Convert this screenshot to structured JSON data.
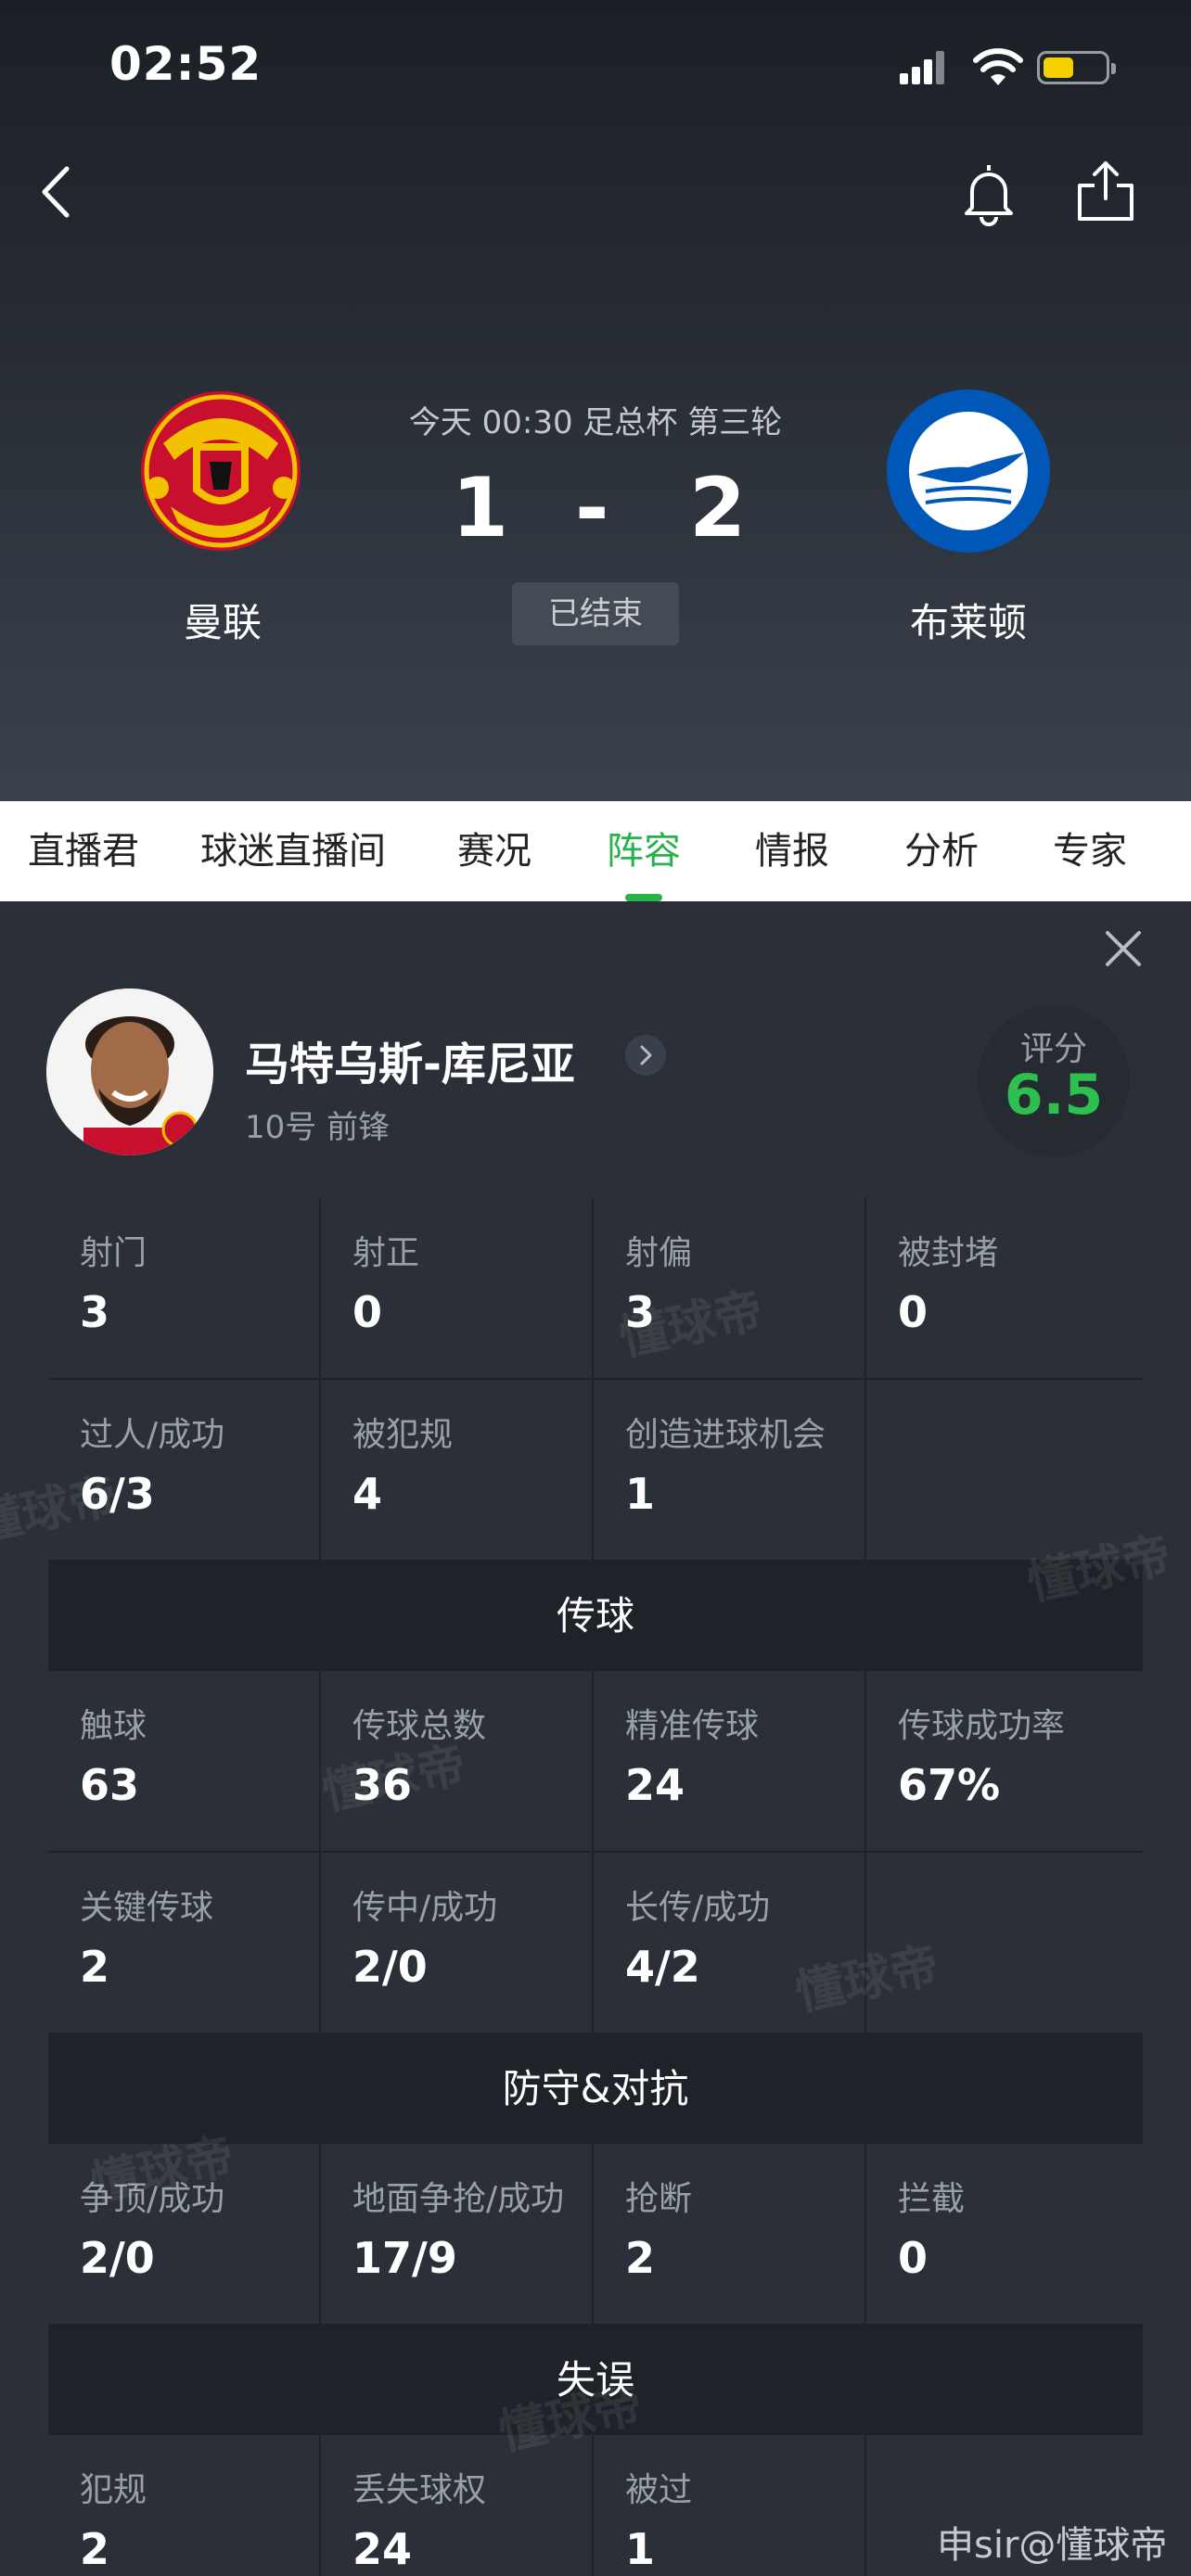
{
  "status_bar": {
    "time": "02:52"
  },
  "match": {
    "meta": "今天 00:30 足总杯 第三轮",
    "home_team": "曼联",
    "away_team": "布莱顿",
    "home_score": "1",
    "separator": "-",
    "away_score": "2",
    "status": "已结束"
  },
  "tabs": [
    {
      "label": "直播君"
    },
    {
      "label": "球迷直播间"
    },
    {
      "label": "赛况"
    },
    {
      "label": "阵容"
    },
    {
      "label": "情报"
    },
    {
      "label": "分析"
    },
    {
      "label": "专家"
    }
  ],
  "active_tab": "阵容",
  "player": {
    "name": "马特乌斯-库尼亚",
    "meta": "10号 前锋",
    "rating_label": "评分",
    "rating": "6.5"
  },
  "stats": {
    "row1": [
      {
        "label": "射门",
        "value": "3"
      },
      {
        "label": "射正",
        "value": "0"
      },
      {
        "label": "射偏",
        "value": "3"
      },
      {
        "label": "被封堵",
        "value": "0"
      }
    ],
    "row2": [
      {
        "label": "过人/成功",
        "value": "6/3"
      },
      {
        "label": "被犯规",
        "value": "4"
      },
      {
        "label": "创造进球机会",
        "value": "1"
      }
    ],
    "passing_title": "传球",
    "row3": [
      {
        "label": "触球",
        "value": "63"
      },
      {
        "label": "传球总数",
        "value": "36"
      },
      {
        "label": "精准传球",
        "value": "24"
      },
      {
        "label": "传球成功率",
        "value": "67%"
      }
    ],
    "row4": [
      {
        "label": "关键传球",
        "value": "2"
      },
      {
        "label": "传中/成功",
        "value": "2/0"
      },
      {
        "label": "长传/成功",
        "value": "4/2"
      }
    ],
    "defense_title": "防守&对抗",
    "row5": [
      {
        "label": "争顶/成功",
        "value": "2/0"
      },
      {
        "label": "地面争抢/成功",
        "value": "17/9"
      },
      {
        "label": "抢断",
        "value": "2"
      },
      {
        "label": "拦截",
        "value": "0"
      }
    ],
    "errors_title": "失误",
    "row6": [
      {
        "label": "犯规",
        "value": "2"
      },
      {
        "label": "丢失球权",
        "value": "24"
      },
      {
        "label": "被过",
        "value": "1"
      }
    ]
  },
  "watermark": "懂球帝",
  "credit": "申sir@懂球帝",
  "colors": {
    "accent": "#28b24b",
    "rating": "#2ec04f",
    "panel": "#2b3038",
    "divider": "#1f2329"
  }
}
